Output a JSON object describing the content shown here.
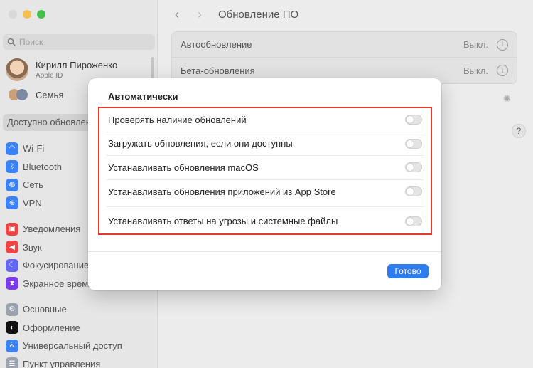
{
  "colors": {
    "close": "#d8d8d8",
    "minimize": "#f4bf4f",
    "zoom": "#45c14b",
    "highlight": "#e5392e",
    "accent": "#2f7bf0"
  },
  "sidebar": {
    "search_placeholder": "Поиск",
    "profile": {
      "name": "Кирилл Пироженко",
      "sub": "Apple ID"
    },
    "family": "Семья",
    "update_banner": "Доступно обновлени",
    "groups": [
      {
        "top": 0,
        "items": [
          {
            "label": "Wi-Fi",
            "icon": "wifi-icon",
            "color": "#3b82f6",
            "glyph": "◠"
          },
          {
            "label": "Bluetooth",
            "icon": "bluetooth-icon",
            "color": "#3b82f6",
            "glyph": "ᛒ"
          },
          {
            "label": "Сеть",
            "icon": "network-icon",
            "color": "#3b82f6",
            "glyph": "◍"
          },
          {
            "label": "VPN",
            "icon": "vpn-icon",
            "color": "#3b82f6",
            "glyph": "⊕"
          }
        ]
      },
      {
        "items": [
          {
            "label": "Уведомления",
            "icon": "notifications-icon",
            "color": "#ef4444",
            "glyph": "▣"
          },
          {
            "label": "Звук",
            "icon": "sound-icon",
            "color": "#ef4444",
            "glyph": "◀"
          },
          {
            "label": "Фокусирование",
            "icon": "focus-icon",
            "color": "#6366f1",
            "glyph": "☾"
          },
          {
            "label": "Экранное время",
            "icon": "screen-time-icon",
            "color": "#7c3aed",
            "glyph": "⧗"
          }
        ]
      },
      {
        "items": [
          {
            "label": "Основные",
            "icon": "general-icon",
            "color": "#9ca3af",
            "glyph": "⚙"
          },
          {
            "label": "Оформление",
            "icon": "appearance-icon",
            "color": "#111111",
            "glyph": "◐"
          },
          {
            "label": "Универсальный доступ",
            "icon": "accessibility-icon",
            "color": "#3b82f6",
            "glyph": "♿"
          },
          {
            "label": "Пункт управления",
            "icon": "control-center-icon",
            "color": "#9ca3af",
            "glyph": "☰"
          }
        ]
      }
    ]
  },
  "main": {
    "title": "Обновление ПО",
    "rows": [
      {
        "label": "Автообновление",
        "value": "Выкл."
      },
      {
        "label": "Бета-обновления",
        "value": "Выкл."
      }
    ]
  },
  "dialog": {
    "title": "Автоматически",
    "options": [
      {
        "label": "Проверять наличие обновлений",
        "on": false
      },
      {
        "label": "Загружать обновления, если они доступны",
        "on": false
      },
      {
        "label": "Устанавливать обновления macOS",
        "on": false
      },
      {
        "label": "Устанавливать обновления приложений из App Store",
        "on": false
      },
      {
        "label": "Устанавливать ответы на угрозы и системные файлы",
        "on": false
      }
    ],
    "done_label": "Готово"
  }
}
